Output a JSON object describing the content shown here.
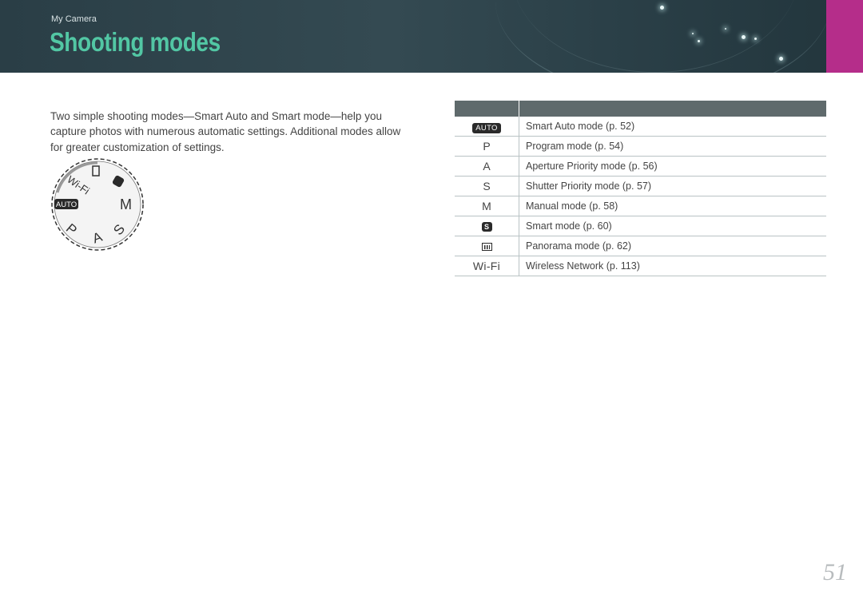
{
  "header": {
    "breadcrumb": "My Camera",
    "title": "Shooting modes",
    "accent_color": "#b52d8a",
    "title_color": "#52c7a4"
  },
  "intro": "Two simple shooting modes—Smart Auto and Smart mode—help you capture photos with numerous automatic settings. Additional modes allow for greater customization of settings.",
  "dial": {
    "labels": [
      "AUTO",
      "Wi-Fi",
      "pano",
      "smart",
      "M",
      "S",
      "A",
      "P"
    ]
  },
  "table": {
    "rows": [
      {
        "icon": "auto-icon",
        "symbol": "AUTO",
        "description": "Smart Auto mode (p. 52)"
      },
      {
        "icon": "p-mode-icon",
        "symbol": "P",
        "description": "Program mode (p. 54)"
      },
      {
        "icon": "a-mode-icon",
        "symbol": "A",
        "description": "Aperture Priority mode (p. 56)"
      },
      {
        "icon": "s-mode-icon",
        "symbol": "S",
        "description": "Shutter Priority mode (p. 57)"
      },
      {
        "icon": "m-mode-icon",
        "symbol": "M",
        "description": "Manual mode (p. 58)"
      },
      {
        "icon": "smart-mode-icon",
        "symbol": "S",
        "description": "Smart mode (p. 60)"
      },
      {
        "icon": "panorama-icon",
        "symbol": "",
        "description": "Panorama mode (p. 62)"
      },
      {
        "icon": "wifi-icon",
        "symbol": "Wi-Fi",
        "description": "Wireless Network (p. 113)"
      }
    ]
  },
  "page_number": "51"
}
